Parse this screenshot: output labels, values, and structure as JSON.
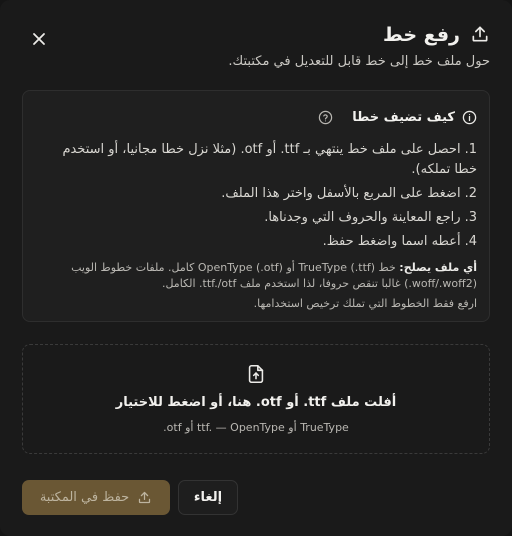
{
  "dialog": {
    "title": "رفع خط",
    "subtitle": "حول ملف خط إلى خط قابل للتعديل في مكتبتك."
  },
  "info": {
    "title": "كيف تضيف خطا",
    "steps": [
      {
        "num": "1.",
        "text": "احصل على ملف خط ينتهي بـ ttf. أو otf. (مثلا نزل خطا مجانيا، أو استخدم خطا تملكه)."
      },
      {
        "num": "2.",
        "text": "اضغط على المربع بالأسفل واختر هذا الملف."
      },
      {
        "num": "3.",
        "text": "راجع المعاينة والحروف التي وجدناها."
      },
      {
        "num": "4.",
        "text": "أعطه اسما واضغط حفظ."
      }
    ],
    "compat_label": "أي ملف يصلح:",
    "compat_text": " خط TrueType (.ttf) أو OpenType (.otf) كامل. ملفات خطوط الويب (woff/.woff2.) غالبا تنقص حروفا، لذا استخدم ملف ttf./otf. الكامل.",
    "license_note": "ارفع فقط الخطوط التي تملك ترخيص استخدامها."
  },
  "dropzone": {
    "main": "أفلت ملف ttf. أو otf. هنا، أو اضغط للاختيار",
    "sub": "TrueType أو ttf. — OpenType أو otf."
  },
  "buttons": {
    "save": "حفظ في المكتبة",
    "cancel": "إلغاء"
  },
  "icons": {
    "title": "upload-icon",
    "close": "close-icon",
    "info": "info-icon",
    "help": "help-circle-icon",
    "file": "file-upload-icon",
    "save": "upload-icon"
  },
  "colors": {
    "background": "#1a1a1a",
    "accent": "#6a5734",
    "panel": "#1f1f1f"
  }
}
